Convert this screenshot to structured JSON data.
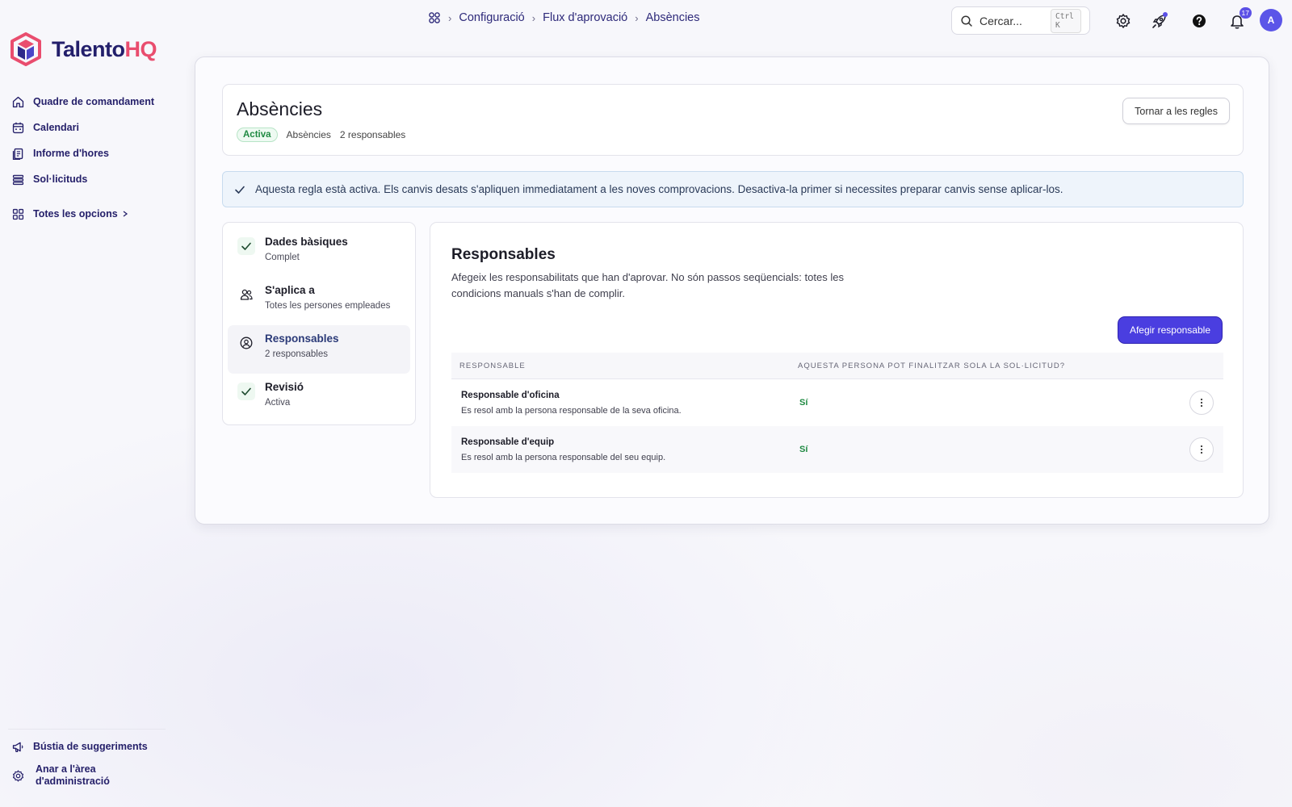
{
  "brand": {
    "name_main": "Talento",
    "name_accent": "HQ",
    "accent_color": "#e94d6e",
    "primary_color": "#231f6b"
  },
  "sidebar": {
    "items": [
      {
        "label": "Quadre de comandament",
        "icon": "home-icon"
      },
      {
        "label": "Calendari",
        "icon": "calendar-icon"
      },
      {
        "label": "Informe d'hores",
        "icon": "report-icon"
      },
      {
        "label": "Sol·licituds",
        "icon": "list-icon"
      }
    ],
    "all_options": "Totes les opcions",
    "bottom_items": [
      {
        "label": "Bústia de suggeriments",
        "icon": "megaphone-icon"
      },
      {
        "label": "Anar a l'àrea d'administració",
        "icon": "gear-icon"
      }
    ]
  },
  "topbar": {
    "breadcrumb": [
      "Configuració",
      "Flux d'aprovació",
      "Absències"
    ],
    "search_placeholder": "Cercar...",
    "search_shortcut": "Ctrl K",
    "notifications_count": "17",
    "avatar_initial": "A"
  },
  "header": {
    "title": "Absències",
    "status": "Activa",
    "category": "Absències",
    "responsables_count": "2 responsables",
    "back_button": "Tornar a les regles"
  },
  "banner": {
    "text": "Aquesta regla està activa. Els canvis desats s'apliquen immediatament a les noves comprovacions. Desactiva-la primer si necessites preparar canvis sense aplicar-los."
  },
  "steps": [
    {
      "title": "Dades bàsiques",
      "subtitle": "Complet",
      "icon": "check-icon"
    },
    {
      "title": "S'aplica a",
      "subtitle": "Totes les persones empleades",
      "icon": "users-icon"
    },
    {
      "title": "Responsables",
      "subtitle": "2 responsables",
      "icon": "user-circle-icon"
    },
    {
      "title": "Revisió",
      "subtitle": "Activa",
      "icon": "check-icon"
    }
  ],
  "content": {
    "title": "Responsables",
    "description": "Afegeix les responsabilitats que han d'aprovar. No són passos seqüencials: totes les condicions manuals s'han de complir.",
    "add_button": "Afegir responsable",
    "table": {
      "headers": [
        "RESPONSABLE",
        "AQUESTA PERSONA POT FINALITZAR SOLA LA SOL·LICITUD?"
      ],
      "rows": [
        {
          "name": "Responsable d'oficina",
          "description": "Es resol amb la persona responsable de la seva oficina.",
          "can_finalize": "Sí"
        },
        {
          "name": "Responsable d'equip",
          "description": "Es resol amb la persona responsable del seu equip.",
          "can_finalize": "Sí"
        }
      ]
    }
  }
}
